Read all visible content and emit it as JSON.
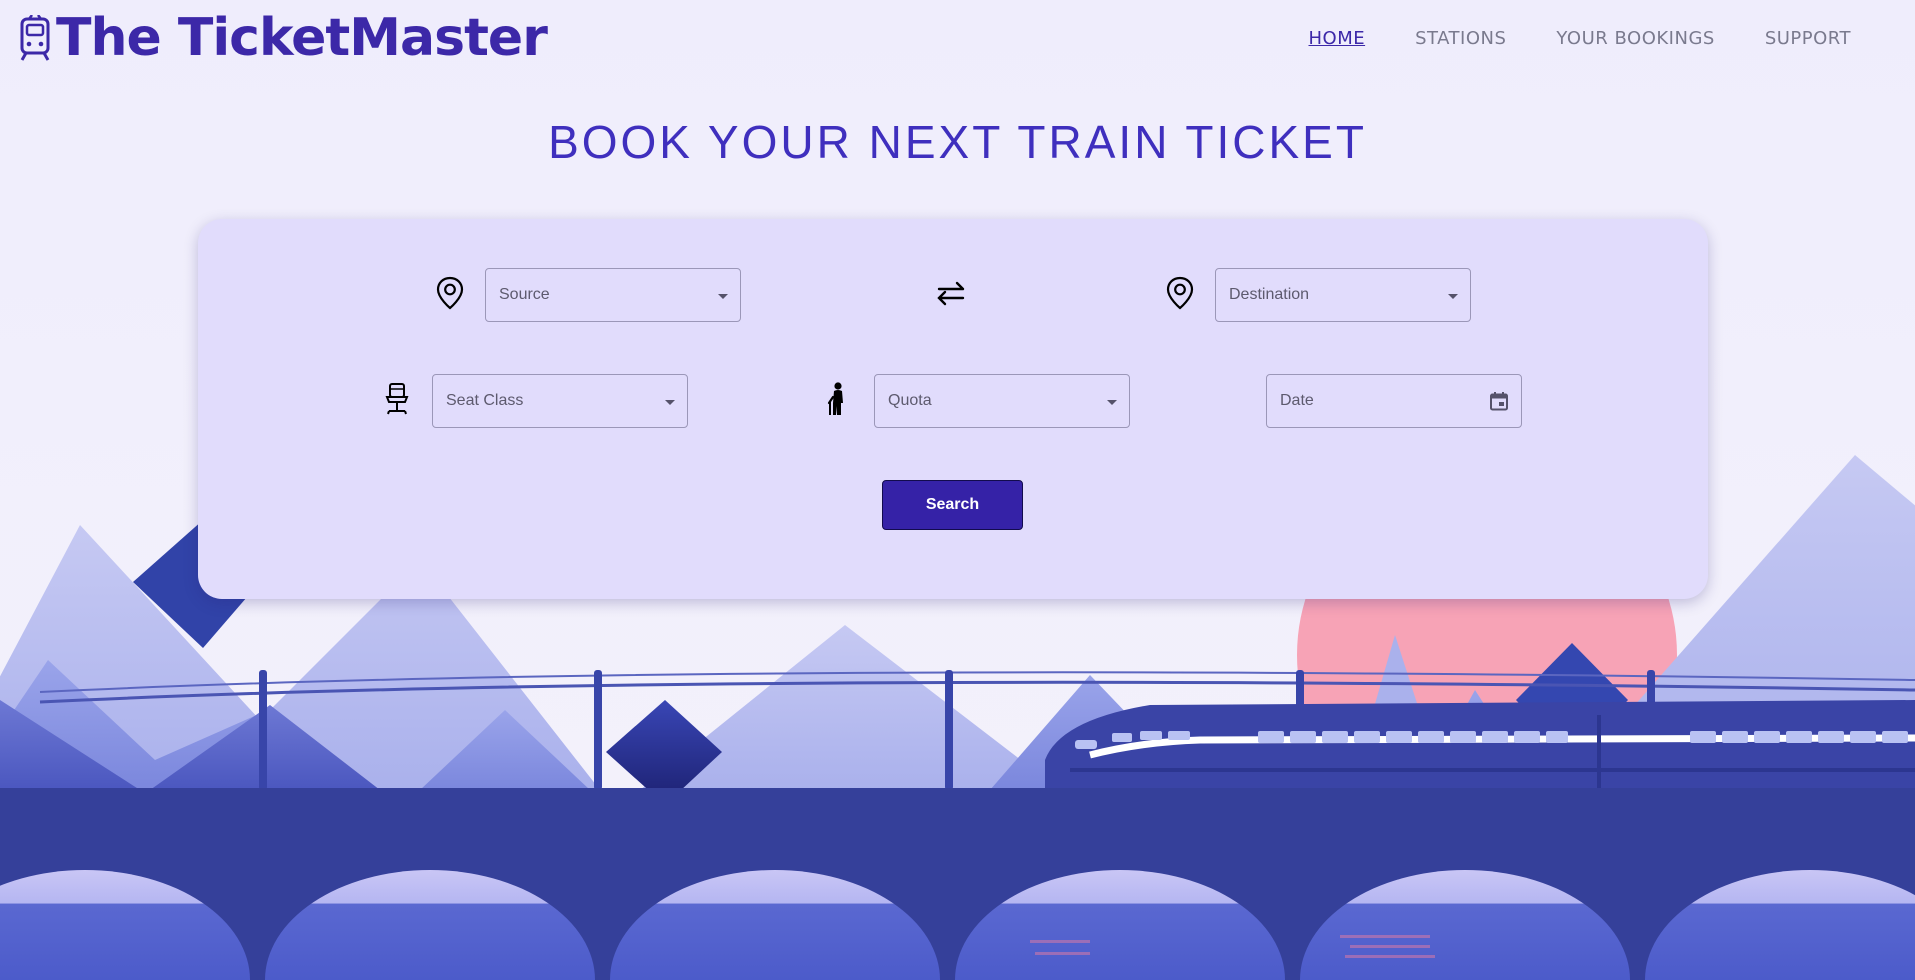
{
  "brand": {
    "name": "The TicketMaster"
  },
  "nav": {
    "items": [
      {
        "label": "HOME",
        "active": true
      },
      {
        "label": "STATIONS",
        "active": false
      },
      {
        "label": "YOUR BOOKINGS",
        "active": false
      },
      {
        "label": "SUPPORT",
        "active": false
      }
    ]
  },
  "page": {
    "title": "BOOK YOUR NEXT TRAIN TICKET"
  },
  "form": {
    "source": {
      "placeholder": "Source",
      "icon": "map-pin-icon"
    },
    "swap": {
      "icon": "swap-arrows-icon"
    },
    "destination": {
      "placeholder": "Destination",
      "icon": "map-pin-icon"
    },
    "seat_class": {
      "placeholder": "Seat Class",
      "icon": "seat-icon"
    },
    "quota": {
      "placeholder": "Quota",
      "icon": "elderly-person-icon"
    },
    "date": {
      "placeholder": "Date",
      "icon": "calendar-icon"
    },
    "search_label": "Search"
  },
  "colors": {
    "accent": "#3c28a8",
    "button": "#3522a7",
    "card": "#e1dcfc",
    "background": "#efedfc",
    "sun": "#f7a3b6",
    "ground": "#35409a"
  }
}
